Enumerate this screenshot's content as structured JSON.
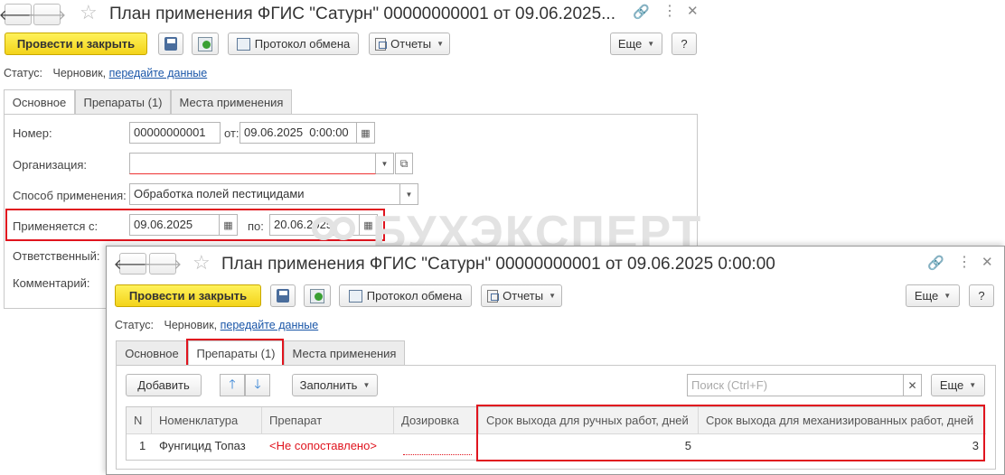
{
  "back_window": {
    "title": "План применения ФГИС \"Сатурн\" 00000000001 от 09.06.2025...",
    "toolbar": {
      "post_close_label": "Провести и закрыть",
      "exchange_protocol_label": "Протокол обмена",
      "reports_label": "Отчеты",
      "more_label": "Еще",
      "help_label": "?"
    },
    "status": {
      "label": "Статус:",
      "value": "Черновик,",
      "link": "передайте данные"
    },
    "tabs": [
      "Основное",
      "Препараты (1)",
      "Места применения"
    ],
    "form": {
      "number_label": "Номер:",
      "number_value": "00000000001",
      "from_label": "от:",
      "from_value": "09.06.2025  0:00:00",
      "org_label": "Организация:",
      "org_value": "",
      "method_label": "Способ применения:",
      "method_value": "Обработка полей пестицидами",
      "applies_from_label": "Применяется с:",
      "applies_from_value": "09.06.2025",
      "to_label": "по:",
      "to_value": "20.06.2025",
      "responsible_label": "Ответственный:",
      "comment_label": "Комментарий:"
    }
  },
  "watermark": "БУХЭКСПЕРТ",
  "front_window": {
    "title": "План применения ФГИС \"Сатурн\" 00000000001 от 09.06.2025 0:00:00",
    "toolbar": {
      "post_close_label": "Провести и закрыть",
      "exchange_protocol_label": "Протокол обмена",
      "reports_label": "Отчеты",
      "more_label": "Еще",
      "help_label": "?"
    },
    "status": {
      "label": "Статус:",
      "value": "Черновик,",
      "link": "передайте данные"
    },
    "tabs": [
      "Основное",
      "Препараты (1)",
      "Места применения"
    ],
    "table_toolbar": {
      "add_label": "Добавить",
      "fill_label": "Заполнить",
      "search_placeholder": "Поиск (Ctrl+F)",
      "more_label": "Еще"
    },
    "table": {
      "headers": [
        "N",
        "Номенклатура",
        "Препарат",
        "Дозировка",
        "Срок выхода для ручных работ, дней",
        "Срок выхода для механизированных работ, дней"
      ],
      "rows": [
        {
          "n": "1",
          "nomenclature": "Фунгицид Топаз",
          "preparation": "<Не сопоставлено>",
          "dosage": "",
          "manual_days": "5",
          "mech_days": "3"
        }
      ]
    }
  }
}
